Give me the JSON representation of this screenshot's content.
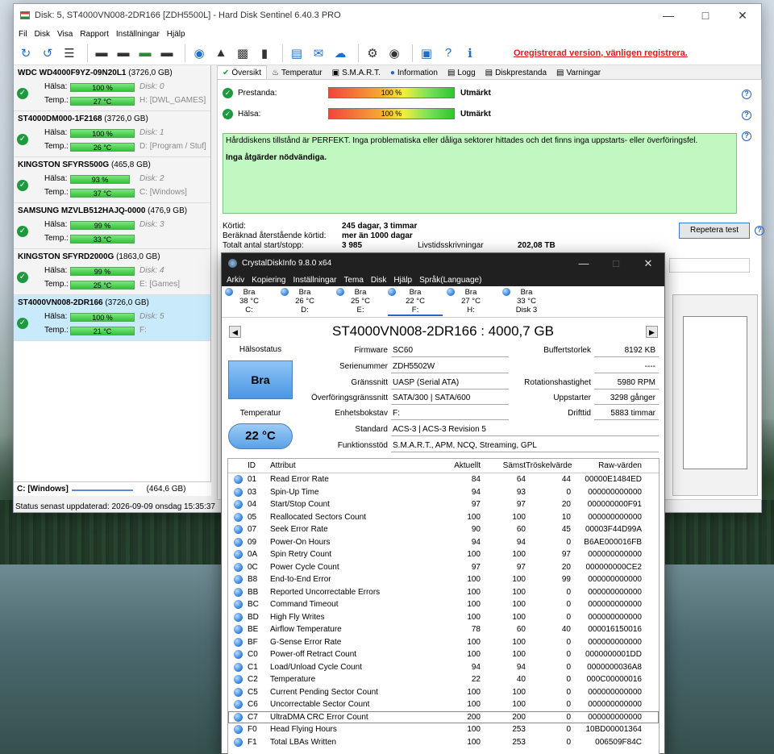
{
  "hds": {
    "title": "Disk: 5, ST4000VN008-2DR166 [ZDH5500L]  -  Hard Disk Sentinel 6.40.3 PRO",
    "menu": [
      "Fil",
      "Disk",
      "Visa",
      "Rapport",
      "Inställningar",
      "Hjälp"
    ],
    "unregistered": "Oregistrerad version, vänligen registrera.",
    "labels": {
      "health": "Hälsa:",
      "temp": "Temp.:"
    },
    "disks": [
      {
        "name": "WDC WD4000F9YZ-09N20L1",
        "size": "(3726,0 GB)",
        "health": "100 %",
        "temp": "27 °C",
        "disk": "Disk: 0",
        "vol": "H: [DWL_GAMES]"
      },
      {
        "name": "ST4000DM000-1F2168",
        "size": "(3726,0 GB)",
        "health": "100 %",
        "temp": "26 °C",
        "disk": "Disk: 1",
        "vol": "D: [Program / Stuf]"
      },
      {
        "name": "KINGSTON SFYRS500G",
        "size": "(465,8 GB)",
        "health": "93 %",
        "temp": "37 °C",
        "disk": "Disk: 2",
        "vol": "C: [Windows]"
      },
      {
        "name": "SAMSUNG MZVLB512HAJQ-0000",
        "size": "(476,9 GB)",
        "health": "99 %",
        "temp": "33 °C",
        "disk": "Disk: 3",
        "vol": ""
      },
      {
        "name": "KINGSTON SFYRD2000G",
        "size": "(1863,0 GB)",
        "health": "99 %",
        "temp": "25 °C",
        "disk": "Disk: 4",
        "vol": "E: [Games]"
      },
      {
        "name": "ST4000VN008-2DR166",
        "size": "(3726,0 GB)",
        "health": "100 %",
        "temp": "21 °C",
        "disk": "Disk: 5",
        "vol": "F:"
      }
    ],
    "volume_bar": {
      "label": "C: [Windows]",
      "size": "(464,6 GB)"
    },
    "status": "Status senast uppdaterad: 2026-09-09 onsdag 15:35:37",
    "tabs": [
      "Översikt",
      "Temperatur",
      "S.M.A.R.T.",
      "Information",
      "Logg",
      "Diskprestanda",
      "Varningar"
    ],
    "perf_label": "Prestanda:",
    "perf_value": "100 %",
    "perf_text": "Utmärkt",
    "health_label": "Hälsa:",
    "health_value": "100 %",
    "health_text": "Utmärkt",
    "message1": "Hårddiskens tillstånd är PERFEKT. Inga problematiska eller dåliga sektorer hittades och det finns inga uppstarts- eller överföringsfel.",
    "message2": "Inga åtgärder nödvändiga.",
    "info": [
      {
        "k": "Körtid:",
        "v": "245 dagar, 3 timmar"
      },
      {
        "k": "Beräknad återstående körtid:",
        "v": "mer än 1000 dagar"
      },
      {
        "k": "Totalt antal start/stopp:",
        "v": "3 985"
      }
    ],
    "lifetime_label": "Livstidsskrivningar",
    "lifetime_value": "202,08 TB",
    "repeat_button": "Repetera test"
  },
  "cdi": {
    "title": "CrystalDiskInfo 9.8.0 x64",
    "menu": [
      "Arkiv",
      "Kopiering",
      "Inställningar",
      "Tema",
      "Disk",
      "Hjälp",
      "Språk(Language)"
    ],
    "disk_tabs": [
      {
        "status": "Bra",
        "temp": "38 °C",
        "drive": "C:"
      },
      {
        "status": "Bra",
        "temp": "26 °C",
        "drive": "D:"
      },
      {
        "status": "Bra",
        "temp": "25 °C",
        "drive": "E:"
      },
      {
        "status": "Bra",
        "temp": "22 °C",
        "drive": "F:"
      },
      {
        "status": "Bra",
        "temp": "27 °C",
        "drive": "H:"
      },
      {
        "status": "Bra",
        "temp": "33 °C",
        "drive": "Disk 3"
      }
    ],
    "model": "ST4000VN008-2DR166 : 4000,7 GB",
    "health_status_label": "Hälsostatus",
    "health_status": "Bra",
    "temperature_label": "Temperatur",
    "temperature": "22 °C",
    "fields": {
      "firmware": {
        "label": "Firmware",
        "value": "SC60"
      },
      "serial": {
        "label": "Serienummer",
        "value": "ZDH5502W"
      },
      "interface": {
        "label": "Gränssnitt",
        "value": "UASP (Serial ATA)"
      },
      "transfer": {
        "label": "Överföringsgränssnitt",
        "value": "SATA/300 | SATA/600"
      },
      "drive_letter": {
        "label": "Enhetsbokstav",
        "value": "F:"
      },
      "standard": {
        "label": "Standard",
        "value": "ACS-3 | ACS-3 Revision 5"
      },
      "features": {
        "label": "Funktionsstöd",
        "value": "S.M.A.R.T., APM, NCQ, Streaming, GPL"
      },
      "buffer": {
        "label": "Buffertstorlek",
        "value": "8192 KB"
      },
      "blank1": {
        "label": "",
        "value": "----"
      },
      "blank2": {
        "label": "",
        "value": "----"
      },
      "rotation": {
        "label": "Rotationshastighet",
        "value": "5980 RPM"
      },
      "power_on_count": {
        "label": "Uppstarter",
        "value": "3298 gånger"
      },
      "power_on_hours": {
        "label": "Drifttid",
        "value": "5883 timmar"
      }
    },
    "smart_headers": {
      "id": "ID",
      "attr": "Attribut",
      "cur": "Aktuellt",
      "worst": "Sämst",
      "thr": "Tröskelvärde",
      "raw": "Raw-värden"
    },
    "smart": [
      {
        "id": "01",
        "attr": "Read Error Rate",
        "cur": "84",
        "worst": "64",
        "thr": "44",
        "raw": "00000E1484ED"
      },
      {
        "id": "03",
        "attr": "Spin-Up Time",
        "cur": "94",
        "worst": "93",
        "thr": "0",
        "raw": "000000000000"
      },
      {
        "id": "04",
        "attr": "Start/Stop Count",
        "cur": "97",
        "worst": "97",
        "thr": "20",
        "raw": "000000000F91"
      },
      {
        "id": "05",
        "attr": "Reallocated Sectors Count",
        "cur": "100",
        "worst": "100",
        "thr": "10",
        "raw": "000000000000"
      },
      {
        "id": "07",
        "attr": "Seek Error Rate",
        "cur": "90",
        "worst": "60",
        "thr": "45",
        "raw": "00003F44D99A"
      },
      {
        "id": "09",
        "attr": "Power-On Hours",
        "cur": "94",
        "worst": "94",
        "thr": "0",
        "raw": "B6AE000016FB"
      },
      {
        "id": "0A",
        "attr": "Spin Retry Count",
        "cur": "100",
        "worst": "100",
        "thr": "97",
        "raw": "000000000000"
      },
      {
        "id": "0C",
        "attr": "Power Cycle Count",
        "cur": "97",
        "worst": "97",
        "thr": "20",
        "raw": "000000000CE2"
      },
      {
        "id": "B8",
        "attr": "End-to-End Error",
        "cur": "100",
        "worst": "100",
        "thr": "99",
        "raw": "000000000000"
      },
      {
        "id": "BB",
        "attr": "Reported Uncorrectable Errors",
        "cur": "100",
        "worst": "100",
        "thr": "0",
        "raw": "000000000000"
      },
      {
        "id": "BC",
        "attr": "Command Timeout",
        "cur": "100",
        "worst": "100",
        "thr": "0",
        "raw": "000000000000"
      },
      {
        "id": "BD",
        "attr": "High Fly Writes",
        "cur": "100",
        "worst": "100",
        "thr": "0",
        "raw": "000000000000"
      },
      {
        "id": "BE",
        "attr": "Airflow Temperature",
        "cur": "78",
        "worst": "60",
        "thr": "40",
        "raw": "000016150016"
      },
      {
        "id": "BF",
        "attr": "G-Sense Error Rate",
        "cur": "100",
        "worst": "100",
        "thr": "0",
        "raw": "000000000000"
      },
      {
        "id": "C0",
        "attr": "Power-off Retract Count",
        "cur": "100",
        "worst": "100",
        "thr": "0",
        "raw": "0000000001DD"
      },
      {
        "id": "C1",
        "attr": "Load/Unload Cycle Count",
        "cur": "94",
        "worst": "94",
        "thr": "0",
        "raw": "0000000036A8"
      },
      {
        "id": "C2",
        "attr": "Temperature",
        "cur": "22",
        "worst": "40",
        "thr": "0",
        "raw": "000C00000016"
      },
      {
        "id": "C5",
        "attr": "Current Pending Sector Count",
        "cur": "100",
        "worst": "100",
        "thr": "0",
        "raw": "000000000000"
      },
      {
        "id": "C6",
        "attr": "Uncorrectable Sector Count",
        "cur": "100",
        "worst": "100",
        "thr": "0",
        "raw": "000000000000"
      },
      {
        "id": "C7",
        "attr": "UltraDMA CRC Error Count",
        "cur": "200",
        "worst": "200",
        "thr": "0",
        "raw": "000000000000"
      },
      {
        "id": "F0",
        "attr": "Head Flying Hours",
        "cur": "100",
        "worst": "253",
        "thr": "0",
        "raw": "10BD00001364"
      },
      {
        "id": "F1",
        "attr": "Total LBAs Written",
        "cur": "100",
        "worst": "253",
        "thr": "0",
        "raw": "006509F84C"
      }
    ],
    "highlight_row_id": "C7"
  }
}
